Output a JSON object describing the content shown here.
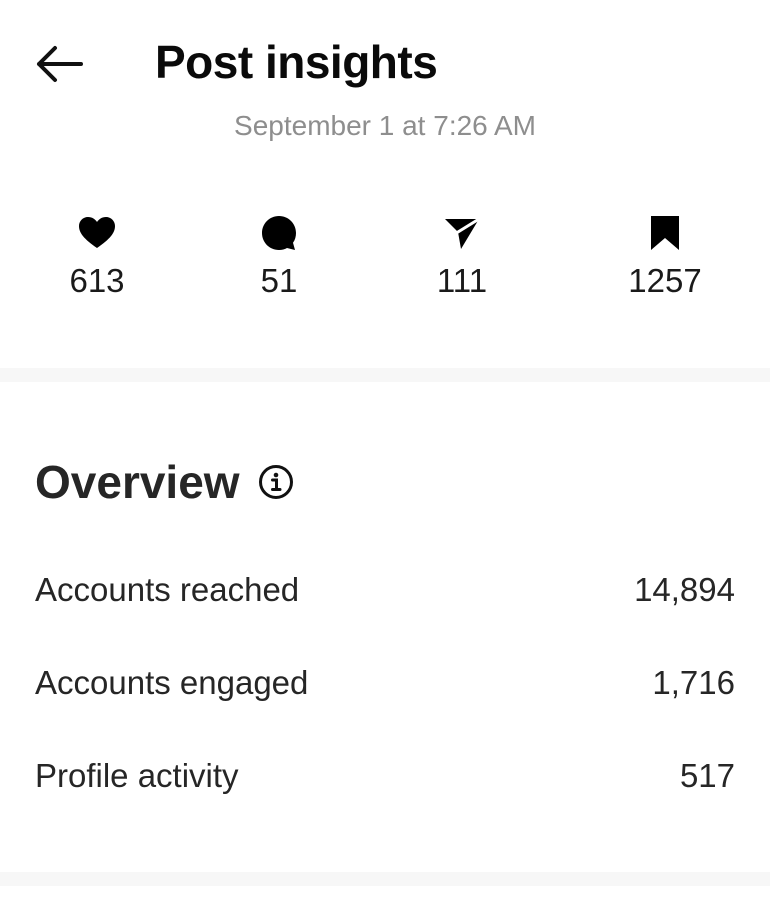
{
  "header": {
    "title": "Post insights",
    "date": "September 1 at 7:26 AM"
  },
  "stats": [
    {
      "icon": "heart-icon",
      "label": "likes",
      "count": "613"
    },
    {
      "icon": "comment-icon",
      "label": "comments",
      "count": "51"
    },
    {
      "icon": "share-icon",
      "label": "shares",
      "count": "111"
    },
    {
      "icon": "bookmark-icon",
      "label": "saves",
      "count": "1257"
    }
  ],
  "overview": {
    "title": "Overview",
    "rows": [
      {
        "label": "Accounts reached",
        "value": "14,894"
      },
      {
        "label": "Accounts engaged",
        "value": "1,716"
      },
      {
        "label": "Profile activity",
        "value": "517"
      }
    ]
  },
  "colors": {
    "text": "#262626",
    "muted": "#8e8e8e",
    "divider": "#f7f7f7"
  }
}
